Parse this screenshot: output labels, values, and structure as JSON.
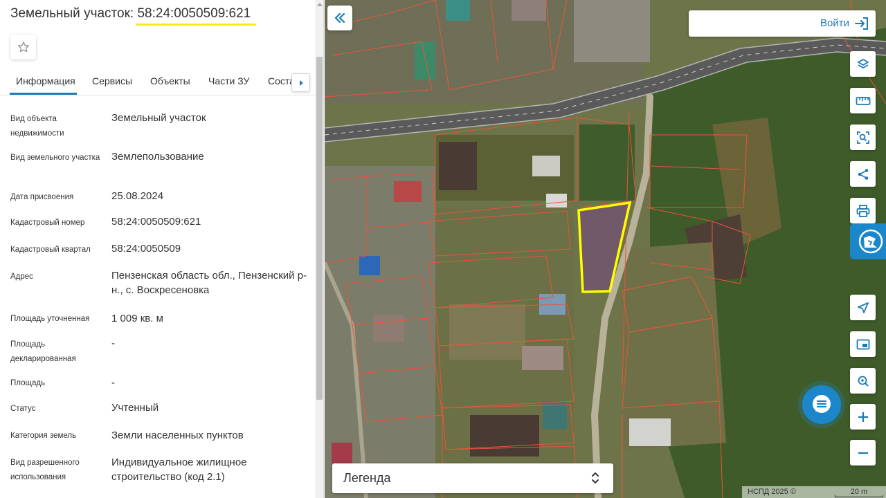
{
  "panel": {
    "title_prefix": "Земельный участок:",
    "title_number": "58:24:0050509:621",
    "tabs": [
      {
        "label": "Информация"
      },
      {
        "label": "Сервисы"
      },
      {
        "label": "Объекты"
      },
      {
        "label": "Части ЗУ"
      },
      {
        "label": "Соста"
      }
    ],
    "properties": [
      {
        "label": "Вид объекта недвижимости",
        "value": "Земельный участок"
      },
      {
        "label": "Вид земельного участка",
        "value": "Землепользование"
      },
      {
        "label": "Дата присвоения",
        "value": "25.08.2024"
      },
      {
        "label": "Кадастровый номер",
        "value": "58:24:0050509:621"
      },
      {
        "label": "Кадастровый квартал",
        "value": "58:24:0050509"
      },
      {
        "label": "Адрес",
        "value": "Пензенская область обл., Пензенский р-н., с. Воскресеновка"
      },
      {
        "label": "Площадь уточненная",
        "value": "1 009 кв. м"
      },
      {
        "label": "Площадь декларированная",
        "value": "-"
      },
      {
        "label": "Площадь",
        "value": "-"
      },
      {
        "label": "Статус",
        "value": "Учтенный"
      },
      {
        "label": "Категория земель",
        "value": "Земли населенных пунктов"
      },
      {
        "label": "Вид разрешенного использования",
        "value": "Индивидуальное жилищное строительство (код 2.1)"
      }
    ]
  },
  "map": {
    "login_label": "Войти",
    "legend_label": "Легенда",
    "attribution": "НСПД 2025 ©",
    "scale_label": "20 m",
    "tools": [
      "layers-icon",
      "ruler-icon",
      "area-select-icon",
      "share-icon",
      "print-icon",
      "cadastral-icon",
      "locate-icon",
      "minimap-icon",
      "search-location-icon",
      "zoom-in-icon",
      "zoom-out-icon",
      "chat-icon"
    ],
    "colors": {
      "accent": "#1b86c9",
      "highlight": "#ffff00",
      "parcel_lines": "#e8553a"
    }
  }
}
